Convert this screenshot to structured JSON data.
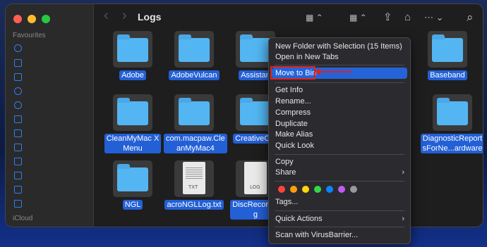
{
  "window": {
    "title": "Logs"
  },
  "colors": {
    "close": "#ff5f57",
    "minimize": "#febc2e",
    "zoom": "#28c840",
    "accent": "#2563d9",
    "annotation": "#e0241c"
  },
  "sidebar": {
    "favourites_heading": "Favourites",
    "icloud_heading": "iCloud",
    "icons": [
      "clock-icon",
      "desktop-icon",
      "document-icon",
      "download-icon",
      "user-icon",
      "folder-icon",
      "folder-icon",
      "folder-icon",
      "folder-icon",
      "folder-icon",
      "folder-icon",
      "folder-icon"
    ]
  },
  "toolbar": {
    "back": "‹",
    "forward": "›",
    "view": "▦ ⌃",
    "group": "▦ ⌃",
    "share": "⇪",
    "tag": "⌂",
    "more": "⋯ ⌄",
    "search": "⌕"
  },
  "items": [
    {
      "name": "Adobe",
      "type": "folder"
    },
    {
      "name": "AdobeVulcan",
      "type": "folder"
    },
    {
      "name": "Assistan",
      "type": "folder"
    },
    {
      "name": "Baseband",
      "type": "folder"
    },
    {
      "name": "CleanMyMac X Menu",
      "type": "folder"
    },
    {
      "name": "com.macpaw.CleanMyMac4",
      "type": "folder"
    },
    {
      "name": "CreativeClo",
      "type": "folder"
    },
    {
      "name": "DiagnosticReportsForNe...ardware",
      "type": "folder"
    },
    {
      "name": "NGL",
      "type": "folder"
    },
    {
      "name": "acroNGLLog.txt",
      "type": "file",
      "tag": "TXT"
    },
    {
      "name": "DiscRecording",
      "type": "file",
      "tag": "LOG"
    }
  ],
  "item_labels": {
    "cleanmymac": [
      "CleanMyMac X",
      "Menu"
    ],
    "commacpaw": [
      "com.macpaw.Cle",
      "anMyMac4"
    ],
    "diagnostic": [
      "DiagnosticReport",
      "sForNe...ardware"
    ],
    "discrecording": [
      "DiscRecordin",
      "g"
    ]
  },
  "context_menu": {
    "new_folder": "New Folder with Selection (15 Items)",
    "open_tabs": "Open in New Tabs",
    "move_to_bin": "Move to Bin",
    "get_info": "Get Info",
    "rename": "Rename...",
    "compress": "Compress",
    "duplicate": "Duplicate",
    "make_alias": "Make Alias",
    "quick_look": "Quick Look",
    "copy": "Copy",
    "share": "Share",
    "tags": "Tags...",
    "quick_actions": "Quick Actions",
    "scan": "Scan with VirusBarrier...",
    "tag_colors": [
      "#ff453a",
      "#ff9f0a",
      "#ffd60a",
      "#32d74b",
      "#0a84ff",
      "#bf5af2",
      "#98989d"
    ]
  }
}
